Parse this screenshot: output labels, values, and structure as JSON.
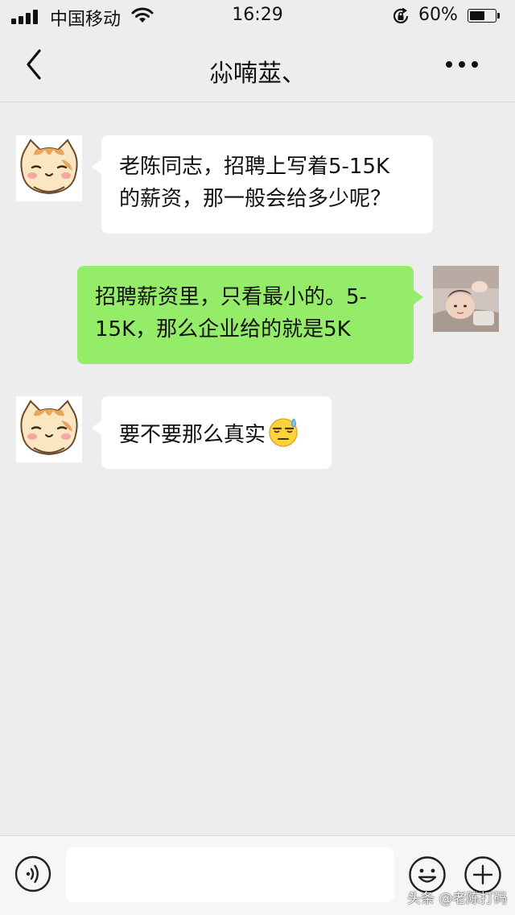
{
  "status_bar": {
    "carrier": "中国移动",
    "time": "16:29",
    "battery_percent": "60%",
    "battery_level": 0.6
  },
  "nav": {
    "title": "尛喃莁、",
    "back_icon": "chevron-left-icon",
    "more_icon": "more-dots-icon"
  },
  "messages": [
    {
      "sender": "contact",
      "lines": [
        "老陈同志，招聘上写着5-15K",
        "的薪资，那一般会给多少呢？"
      ]
    },
    {
      "sender": "me",
      "lines": [
        "招聘薪资里，只看最小的。5-",
        "15K，那么企业给的就是5K"
      ]
    },
    {
      "sender": "contact",
      "text": "要不要那么真实",
      "emoji": "sweat-smile-emoji"
    }
  ],
  "input_bar": {
    "placeholder": "",
    "value": "",
    "voice_icon": "voice-icon",
    "emoji_icon": "emoji-icon",
    "plus_icon": "plus-icon"
  },
  "watermark": "头条 @老陈打码",
  "colors": {
    "background": "#ededed",
    "incoming_bubble": "#ffffff",
    "outgoing_bubble": "#95ec69"
  }
}
